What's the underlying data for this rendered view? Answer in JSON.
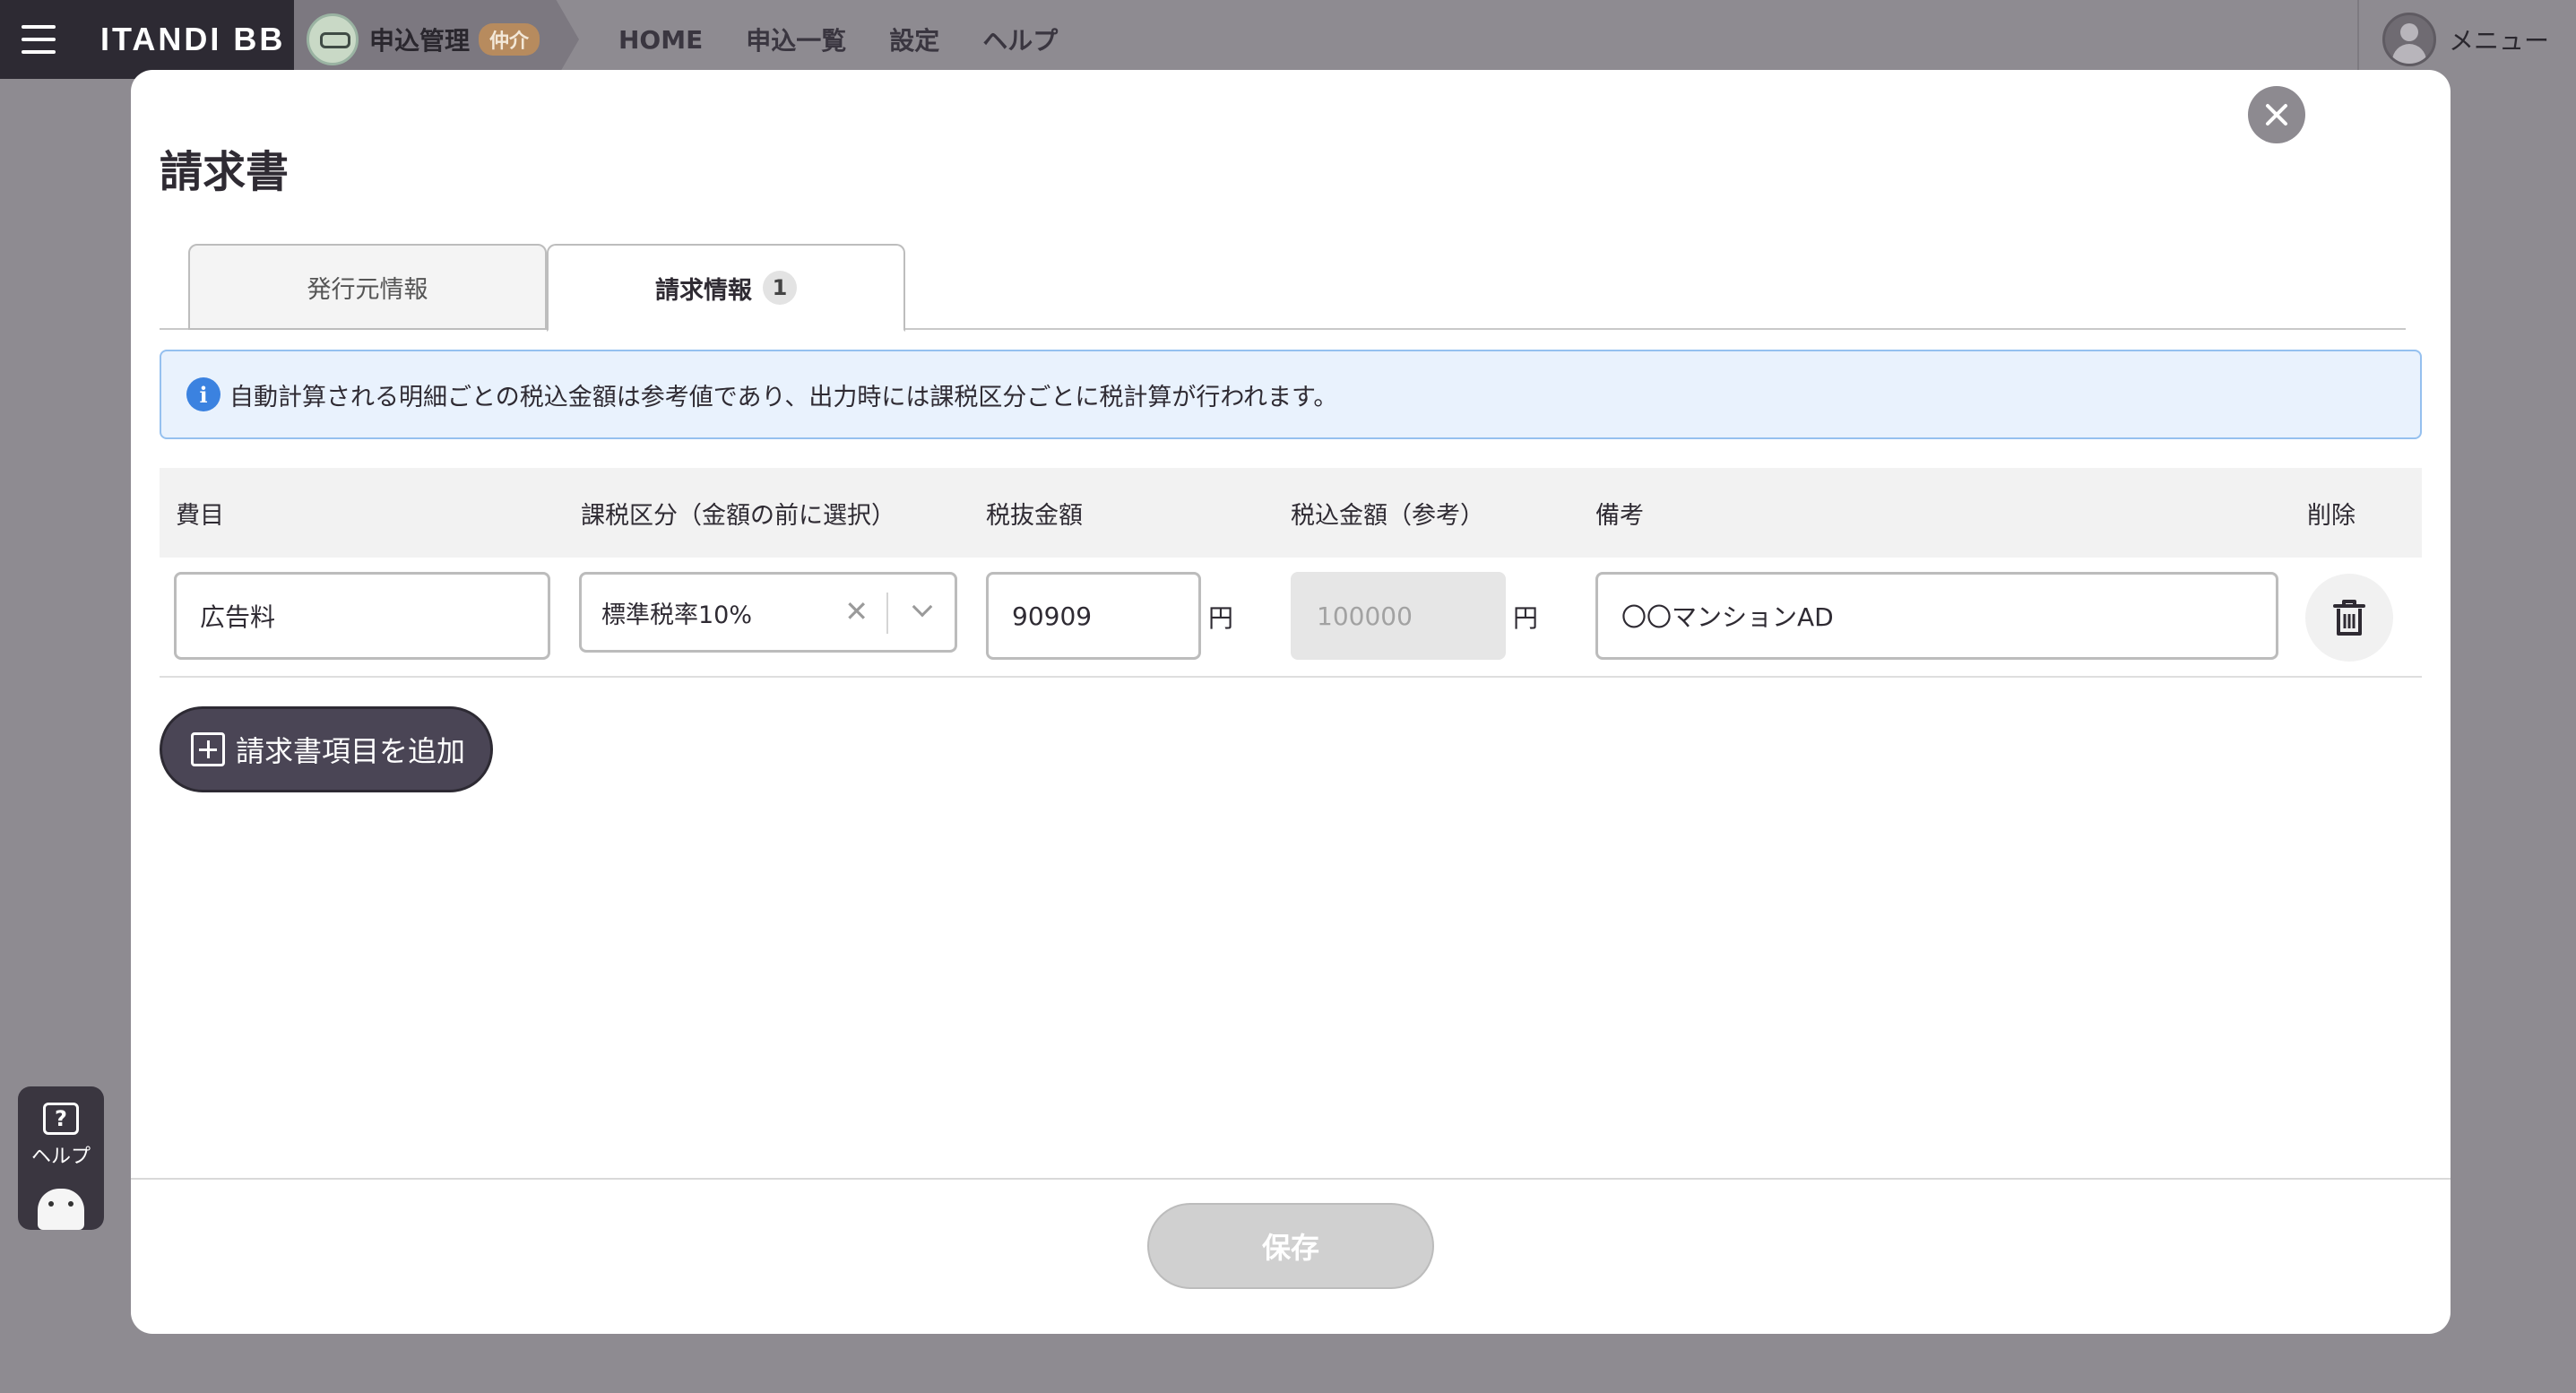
{
  "topbar": {
    "brand": "ITANDI BB",
    "app_title": "申込管理",
    "app_badge": "仲介",
    "nav": [
      "HOME",
      "申込一覧",
      "設定",
      "ヘルプ"
    ],
    "menu_label": "メニュー"
  },
  "help_widget": {
    "label": "ヘルプ",
    "icon_text": "?"
  },
  "modal": {
    "title": "請求書",
    "tabs": [
      {
        "label": "発行元情報",
        "active": false
      },
      {
        "label": "請求情報",
        "active": true,
        "count": "1"
      }
    ],
    "info": "自動計算される明細ごとの税込金額は参考値であり、出力時には課税区分ごとに税計算が行われます。",
    "columns": {
      "item": "費目",
      "tax_class": "課税区分（金額の前に選択）",
      "amount_ex": "税抜金額",
      "amount_in": "税込金額（参考）",
      "note": "備考",
      "delete": "削除"
    },
    "rows": [
      {
        "item": "広告料",
        "tax_class": "標準税率10%",
        "amount_ex": "90909",
        "amount_in": "100000",
        "currency": "円",
        "note": "〇〇マンションAD"
      }
    ],
    "add_button": "請求書項目を追加",
    "save_button": "保存"
  }
}
